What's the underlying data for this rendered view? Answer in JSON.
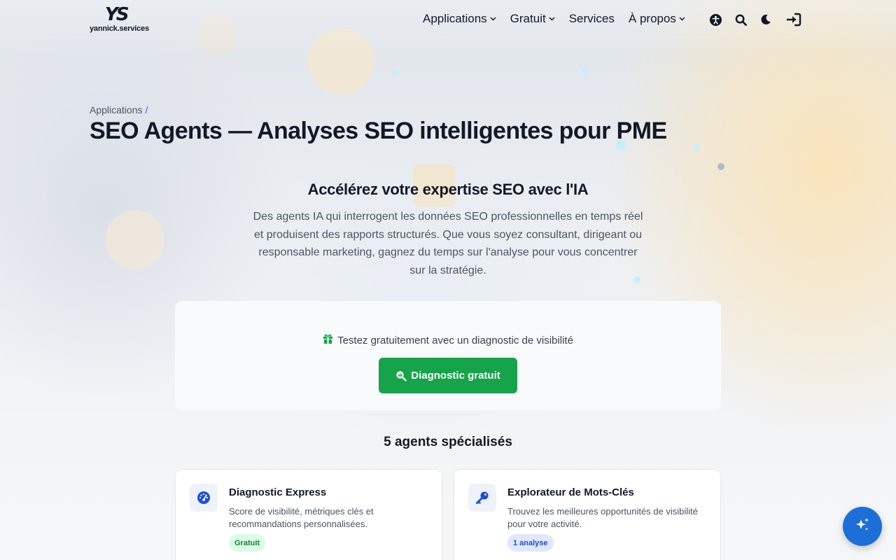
{
  "brand": {
    "mark": "YS",
    "name": "yannick.services"
  },
  "nav": {
    "items": [
      {
        "label": "Applications",
        "has_dropdown": true
      },
      {
        "label": "Gratuit",
        "has_dropdown": true
      },
      {
        "label": "Services",
        "has_dropdown": false
      },
      {
        "label": "À propos",
        "has_dropdown": true
      }
    ],
    "icons": [
      "accessibility-icon",
      "search-icon",
      "dark-mode-moon-icon",
      "login-icon"
    ]
  },
  "breadcrumb": {
    "parent": "Applications",
    "separator": "/"
  },
  "page_title": "SEO Agents — Analyses SEO intelligentes pour PME",
  "hero": {
    "title": "Accélérez votre expertise SEO avec l'IA",
    "description": "Des agents IA qui interrogent les données SEO professionnelles en temps réel et produisent des rapports structurés. Que vous soyez consultant, dirigeant ou responsable marketing, gagnez du temps sur l'analyse pour vous concentrer sur la stratégie."
  },
  "cta": {
    "text": "Testez gratuitement avec un diagnostic de visibilité",
    "button_label": "Diagnostic gratuit",
    "button_color": "#16a34a"
  },
  "agents_section": {
    "title": "5 agents spécialisés",
    "cards": [
      {
        "name": "Diagnostic Express",
        "description": "Score de visibilité, métriques clés et recommandations personnalisées.",
        "badge": "Gratuit",
        "icon": "gauge-icon"
      },
      {
        "name": "Explorateur de Mots-Clés",
        "description": "Trouvez les meilleures opportunités de visibilité pour votre activité.",
        "badge": "1 analyse",
        "icon": "key-icon"
      }
    ]
  },
  "fab": {
    "icon": "ai-sparkle-icon",
    "color": "#1d6fd8"
  },
  "colors": {
    "accent": "#2563eb",
    "success": "#16a34a",
    "text": "#111827"
  }
}
